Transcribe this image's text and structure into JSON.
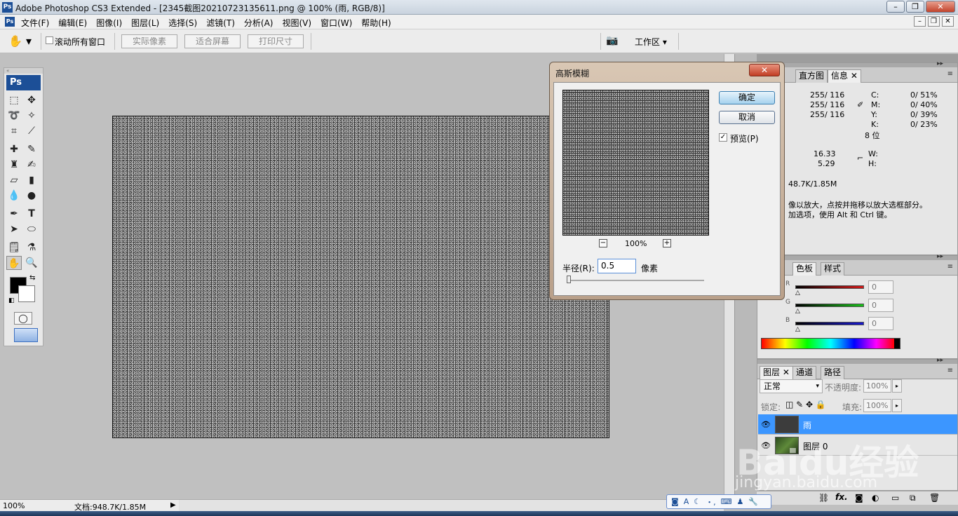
{
  "window": {
    "title": "Adobe Photoshop CS3 Extended - [2345截图20210723135611.png @ 100% (雨, RGB/8)]",
    "logo": "Ps"
  },
  "menu": [
    "文件(F)",
    "编辑(E)",
    "图像(I)",
    "图层(L)",
    "选择(S)",
    "滤镜(T)",
    "分析(A)",
    "视图(V)",
    "窗口(W)",
    "帮助(H)"
  ],
  "options": {
    "scroll_all": "滚动所有窗口",
    "actual_pixels": "实际像素",
    "fit_screen": "适合屏幕",
    "print_size": "打印尺寸",
    "workspace": "工作区"
  },
  "toolbox": {
    "logo": "Ps"
  },
  "dialog": {
    "title": "高斯模糊",
    "ok": "确定",
    "cancel": "取消",
    "preview_label": "预览(P)",
    "preview_checked": true,
    "zoom": "100%",
    "radius_label": "半径(R):",
    "radius_value": "0.5",
    "radius_unit": "像素"
  },
  "info_panel": {
    "tabs": [
      "直方图",
      "信息"
    ],
    "rgb_rows": [
      "255/ 116",
      "255/ 116",
      "255/ 116"
    ],
    "cmyk_labels": [
      "C:",
      "M:",
      "Y:",
      "K:"
    ],
    "cmyk_values": [
      "0/  51%",
      "0/  40%",
      "0/  39%",
      "0/  23%"
    ],
    "bit_depth": "8 位",
    "x": "16.33",
    "y": "5.29",
    "w_label": "W:",
    "h_label": "H:",
    "doc": "48.7K/1.85M",
    "hint1": "像以放大，点按并拖移以放大选框部分。",
    "hint2": "加选项，使用 Alt 和 Ctrl 键。"
  },
  "color_panel": {
    "tabs": [
      "色板",
      "样式"
    ],
    "channels": [
      {
        "letter": "R",
        "value": "0",
        "color": "#d01818"
      },
      {
        "letter": "G",
        "value": "0",
        "color": "#18c018"
      },
      {
        "letter": "B",
        "value": "0",
        "color": "#1818d0"
      }
    ]
  },
  "layers_panel": {
    "tabs": [
      "图层",
      "通道",
      "路径"
    ],
    "blend_mode": "正常",
    "opacity_label": "不透明度:",
    "opacity": "100%",
    "lock_label": "锁定:",
    "fill_label": "填充:",
    "fill": "100%",
    "layers": [
      {
        "name": "雨",
        "selected": true
      },
      {
        "name": "图层 0",
        "selected": false
      }
    ]
  },
  "status": {
    "zoom": "100%",
    "doc": "文档:948.7K/1.85M"
  },
  "watermark": {
    "brand": "Baidu经验",
    "url": "jingyan.baidu.com"
  }
}
